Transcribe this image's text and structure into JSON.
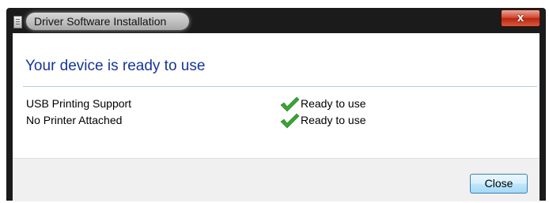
{
  "window": {
    "title": "Driver Software Installation",
    "close_glyph": "x"
  },
  "main": {
    "heading": "Your device is ready to use",
    "devices": [
      {
        "name": "USB Printing Support",
        "status": "Ready to use",
        "status_icon": "green-checkmark-icon"
      },
      {
        "name": "No Printer Attached",
        "status": "Ready to use",
        "status_icon": "green-checkmark-icon"
      }
    ]
  },
  "footer": {
    "close_label": "Close"
  },
  "colors": {
    "heading": "#15359a",
    "check": "#3aa335",
    "close_x": "#c8391f"
  }
}
